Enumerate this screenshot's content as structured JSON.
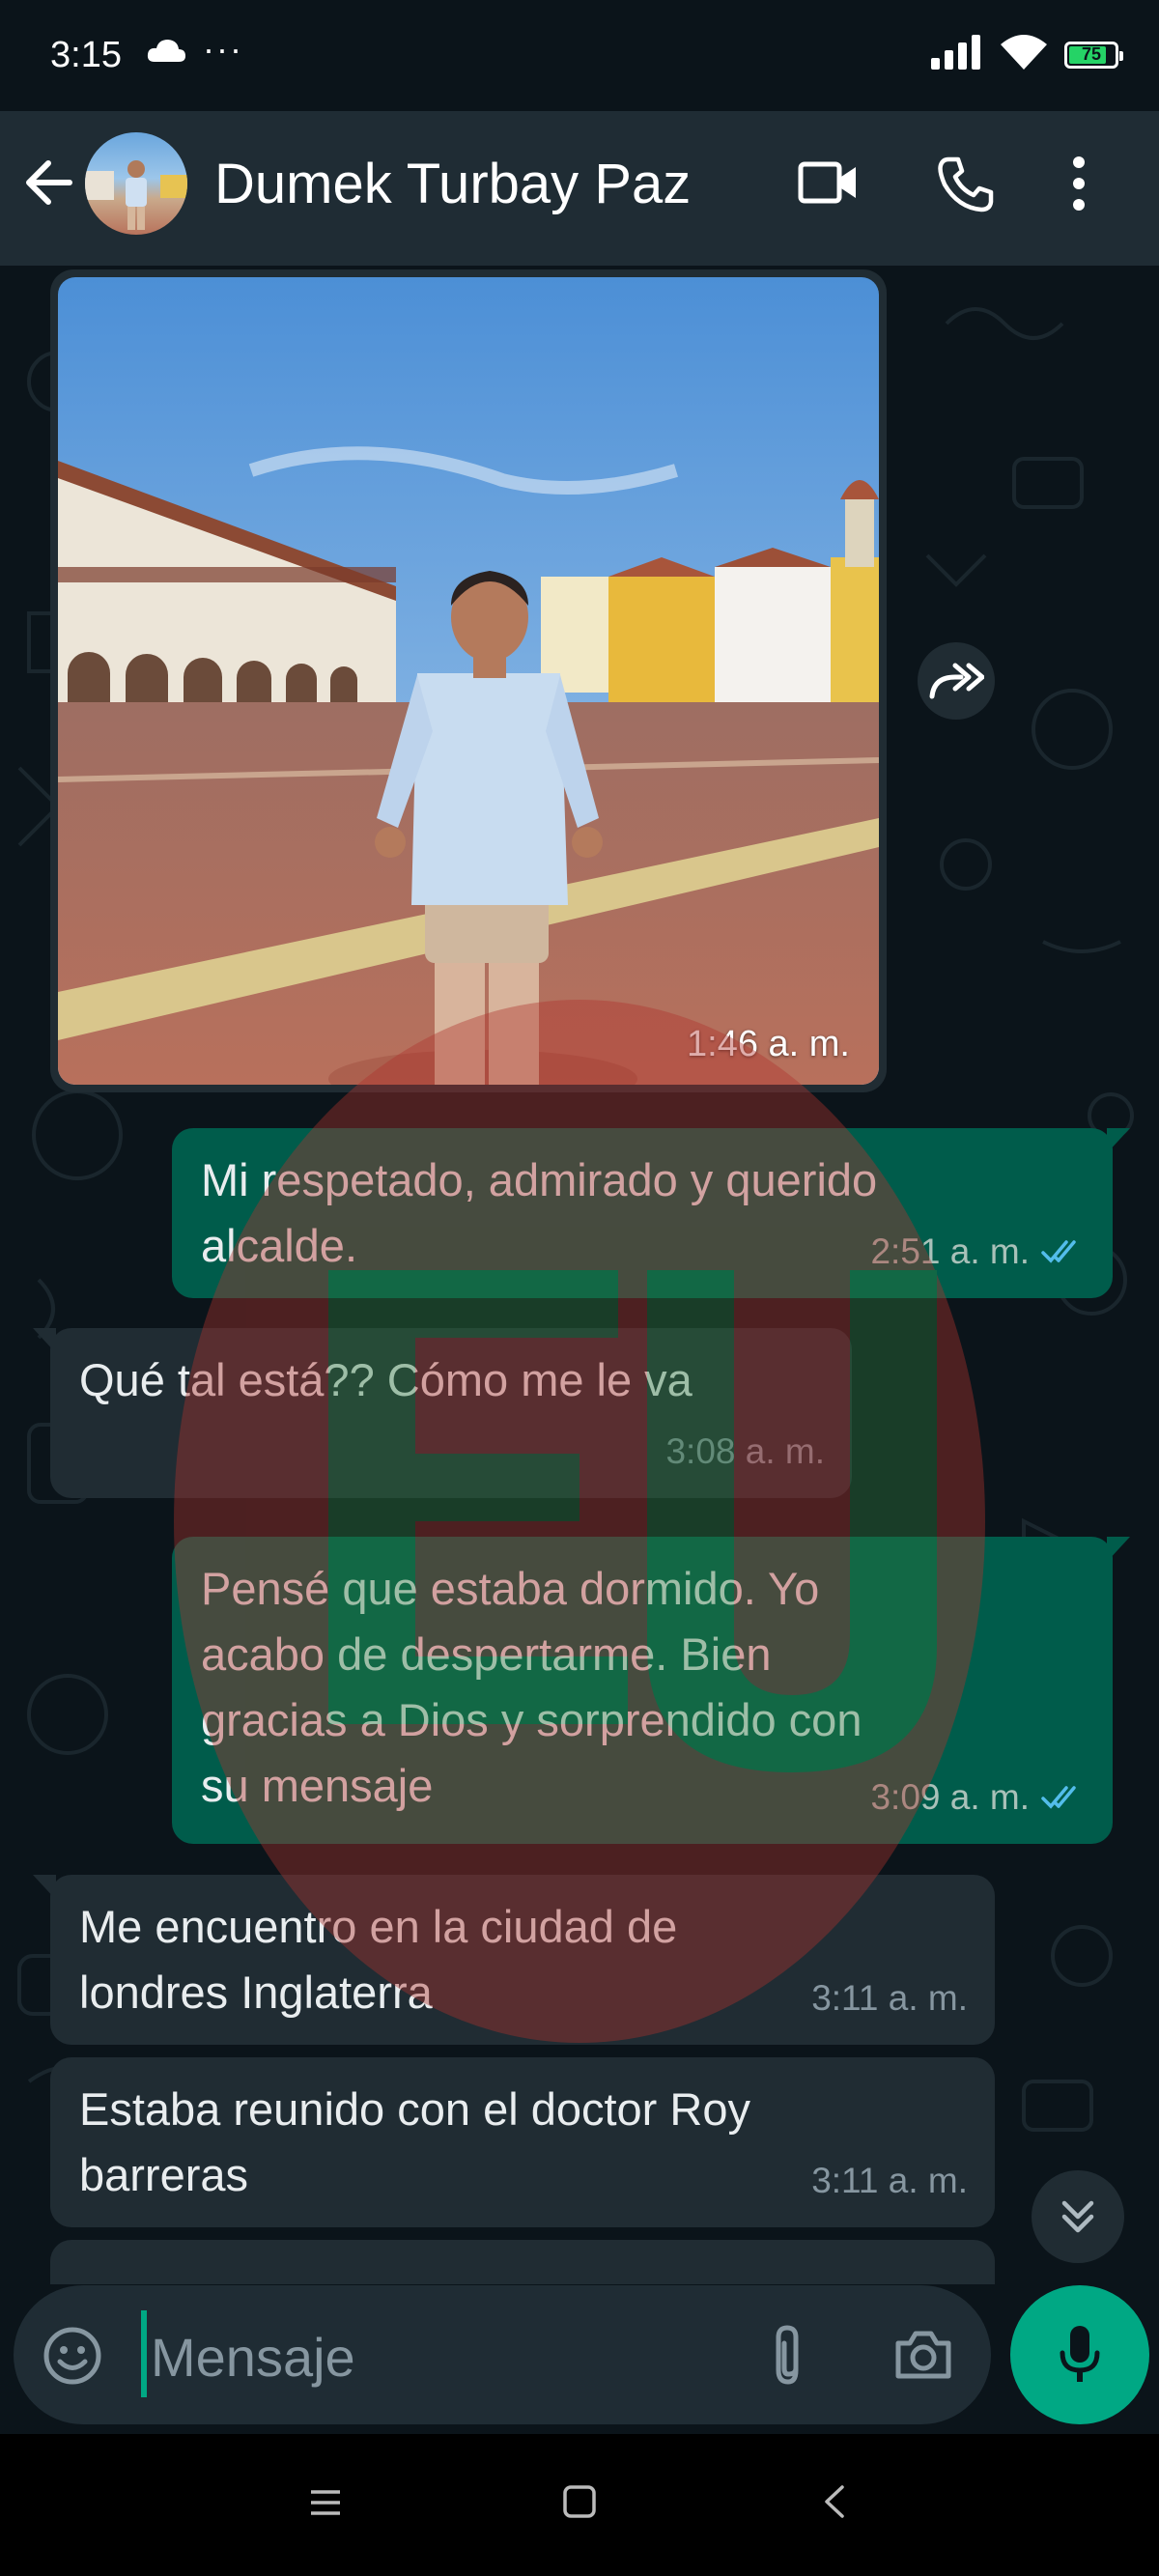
{
  "status_bar": {
    "time": "3:15",
    "dots": "···",
    "battery": "75"
  },
  "header": {
    "contact_name": "Dumek Turbay Paz",
    "icons": [
      "back-arrow-icon",
      "avatar",
      "video-call-icon",
      "phone-call-icon",
      "more-options-icon"
    ]
  },
  "messages": [
    {
      "type": "image",
      "direction": "in",
      "time": "1:46 a. m."
    },
    {
      "type": "text",
      "direction": "out",
      "lines": [
        "Mi respetado, admirado y querido",
        "alcalde."
      ],
      "time": "2:51 a. m.",
      "status": "read"
    },
    {
      "type": "text",
      "direction": "in",
      "lines": [
        "Qué tal está?? Cómo me le va"
      ],
      "time": "3:08 a. m."
    },
    {
      "type": "text",
      "direction": "out",
      "lines": [
        "Pensé que estaba dormido. Yo",
        "acabo de despertarme. Bien",
        "gracias a Dios y sorprendido con",
        "su mensaje"
      ],
      "time": "3:09 a. m.",
      "status": "read"
    },
    {
      "type": "text",
      "direction": "in",
      "lines": [
        "Me encuentro en la ciudad de",
        "londres Inglaterra"
      ],
      "time": "3:11 a. m."
    },
    {
      "type": "text",
      "direction": "in",
      "lines": [
        "Estaba reunido con el doctor Roy",
        "barreras"
      ],
      "time": "3:11 a. m."
    }
  ],
  "composer": {
    "placeholder": "Mensaje"
  },
  "colors": {
    "background": "#0b141a",
    "header": "#1f2c34",
    "outgoing_bubble": "#005c4b",
    "incoming_bubble": "#202c33",
    "accent": "#00a884",
    "read_ticks": "#53bdeb"
  }
}
